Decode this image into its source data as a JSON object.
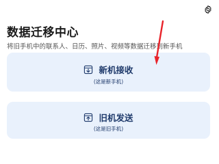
{
  "header": {
    "settings_icon": "gear-icon",
    "title": "数据迁移中心",
    "subtitle": "将旧手机中的联系人、日历、照片、视频等数据迁移到新手机"
  },
  "cards": {
    "new_phone": {
      "icon": "download-tray-icon",
      "label": "新机接收",
      "sublabel": "(这是新手机)"
    },
    "old_phone": {
      "icon": "upload-tray-icon",
      "label": "旧机发送",
      "sublabel": "(这是旧手机)"
    }
  },
  "annotation": {
    "icon": "red-arrow-icon"
  },
  "colors": {
    "card_background": "#e9f1fc",
    "card_text": "#1f3a6b",
    "title_text": "#1a1a1a",
    "subtitle_text": "#555555",
    "annotation_arrow": "#e8232a"
  }
}
